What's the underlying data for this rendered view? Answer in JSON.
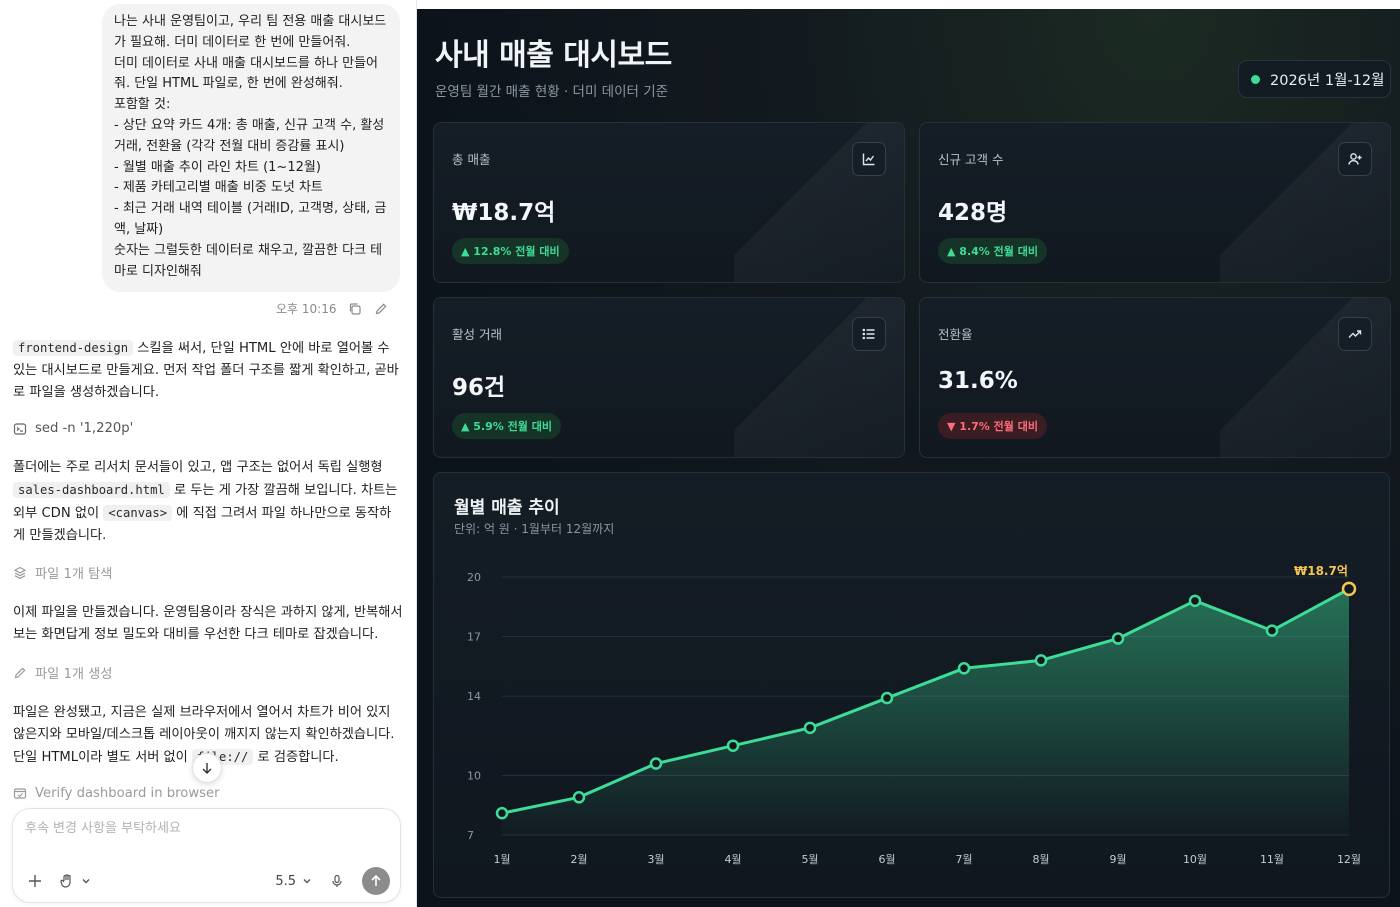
{
  "chat": {
    "user_message": "나는 사내 운영팀이고, 우리 팀 전용 매출 대시보드가 필요해. 더미 데이터로 한 번에 만들어줘.\n더미 데이터로 사내 매출 대시보드를 하나 만들어줘. 단일 HTML 파일로, 한 번에 완성해줘.\n포함할 것:\n- 상단 요약 카드 4개: 총 매출, 신규 고객 수, 활성 거래, 전환율 (각각 전월 대비 증감률 표시)\n- 월별 매출 추이 라인 차트 (1~12월)\n- 제품 카테고리별 매출 비중 도넛 차트\n- 최근 거래 내역 테이블 (거래ID, 고객명, 상태, 금액, 날짜)\n숫자는 그럴듯한 데이터로 채우고, 깔끔한 다크 테마로 디자인해줘",
    "timestamp": "오후 10:16",
    "msg1_code": "frontend-design",
    "msg1_text": " 스킬을 써서, 단일 HTML 안에 바로 열어볼 수 있는 대시보드로 만들게요. 먼저 작업 폴더 구조를 짧게 확인하고, 곧바로 파일을 생성하겠습니다.",
    "step1": "sed -n '1,220p'",
    "msg2_a": "폴더에는 주로 리서치 문서들이 있고, 앱 구조는 없어서 독립 실행형 ",
    "msg2_code1": "sales-dashboard.html",
    "msg2_b": " 로 두는 게 가장 깔끔해 보입니다. 차트는 외부 CDN 없이 ",
    "msg2_code2": "<canvas>",
    "msg2_c": " 에 직접 그려서 파일 하나만으로 동작하게 만들겠습니다.",
    "step2": "파일 1개 탐색",
    "msg3": "이제 파일을 만들겠습니다. 운영팀용이라 장식은 과하지 않게, 반복해서 보는 화면답게 정보 밀도와 대비를 우선한 다크 테마로 잡겠습니다.",
    "step3": "파일 1개 생성",
    "msg4_a": "파일은 완성됐고, 지금은 실제 브라우저에서 열어서 차트가 비어 있지 않은지와 모바일/데스크톱 레이아웃이 깨지지 않는지 확인하겠습니다. 단일 HTML이라 별도 서버 없이 ",
    "msg4_code": "file://",
    "msg4_b": " 로 검증합니다.",
    "step4": "Verify dashboard in browser",
    "composer_placeholder": "후속 변경 사항을 부탁하세요",
    "model_label": "5.5"
  },
  "dashboard": {
    "title": "사내 매출 대시보드",
    "subtitle": "운영팀 월간 매출 현황 · 더미 데이터 기준",
    "period": "2026년 1월-12월",
    "accent": "#3ddc97",
    "down_color": "#ff6b7a",
    "cards": [
      {
        "label": "총 매출",
        "value": "₩18.7억",
        "change": "▲ 12.8% 전월 대비",
        "trend": "up",
        "icon": "line-chart-icon"
      },
      {
        "label": "신규 고객 수",
        "value": "428명",
        "change": "▲ 8.4% 전월 대비",
        "trend": "up",
        "icon": "user-plus-icon"
      },
      {
        "label": "활성 거래",
        "value": "96건",
        "change": "▲ 5.9% 전월 대비",
        "trend": "up",
        "icon": "list-icon"
      },
      {
        "label": "전환율",
        "value": "31.6%",
        "change": "▼ 1.7% 전월 대비",
        "trend": "down",
        "icon": "trending-up-icon"
      }
    ]
  },
  "chart_data": {
    "type": "line",
    "title": "월별 매출 추이",
    "subtitle": "단위: 억 원 · 1월부터 12월까지",
    "categories": [
      "1월",
      "2월",
      "3월",
      "4월",
      "5월",
      "6월",
      "7월",
      "8월",
      "9월",
      "10월",
      "11월",
      "12월"
    ],
    "values": [
      8.1,
      8.9,
      10.6,
      11.5,
      12.4,
      13.9,
      15.4,
      15.8,
      16.9,
      18.8,
      17.3,
      19.4
    ],
    "yticks": [
      20,
      17,
      14,
      10,
      7
    ],
    "ylim": [
      7,
      20
    ],
    "highlight_label": "₩18.7억",
    "line_color": "#3ddc97",
    "highlight_color": "#f5c451",
    "grid": true
  }
}
